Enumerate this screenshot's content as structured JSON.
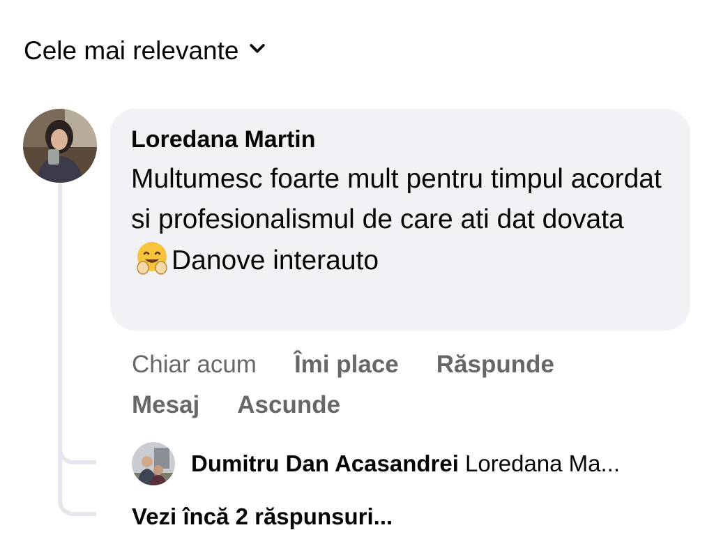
{
  "sort": {
    "label": "Cele mai relevante",
    "icon": "chevron-down-icon"
  },
  "comment": {
    "author": "Loredana Martin",
    "text_before_emoji": "Multumesc foarte mult pentru timpul acordat si profesionalismul de care ati dat dovata ",
    "emoji": "hugging-face-icon",
    "text_after_emoji": "Danove interauto",
    "avatar": "user-avatar-photo"
  },
  "actions": {
    "time": "Chiar acum",
    "like": "Îmi place",
    "reply": "Răspunde",
    "message": "Mesaj",
    "hide": "Ascunde"
  },
  "reply_preview": {
    "author": "Dumitru Dan Acasandrei",
    "text": "Loredana Ma...",
    "avatar": "user-avatar-photo"
  },
  "more_replies": {
    "label": "Vezi încă 2 răspunsuri..."
  },
  "colors": {
    "bubble": "#f0f2f5",
    "secondary_text": "#65676b",
    "thread_line": "#e4e6eb"
  }
}
